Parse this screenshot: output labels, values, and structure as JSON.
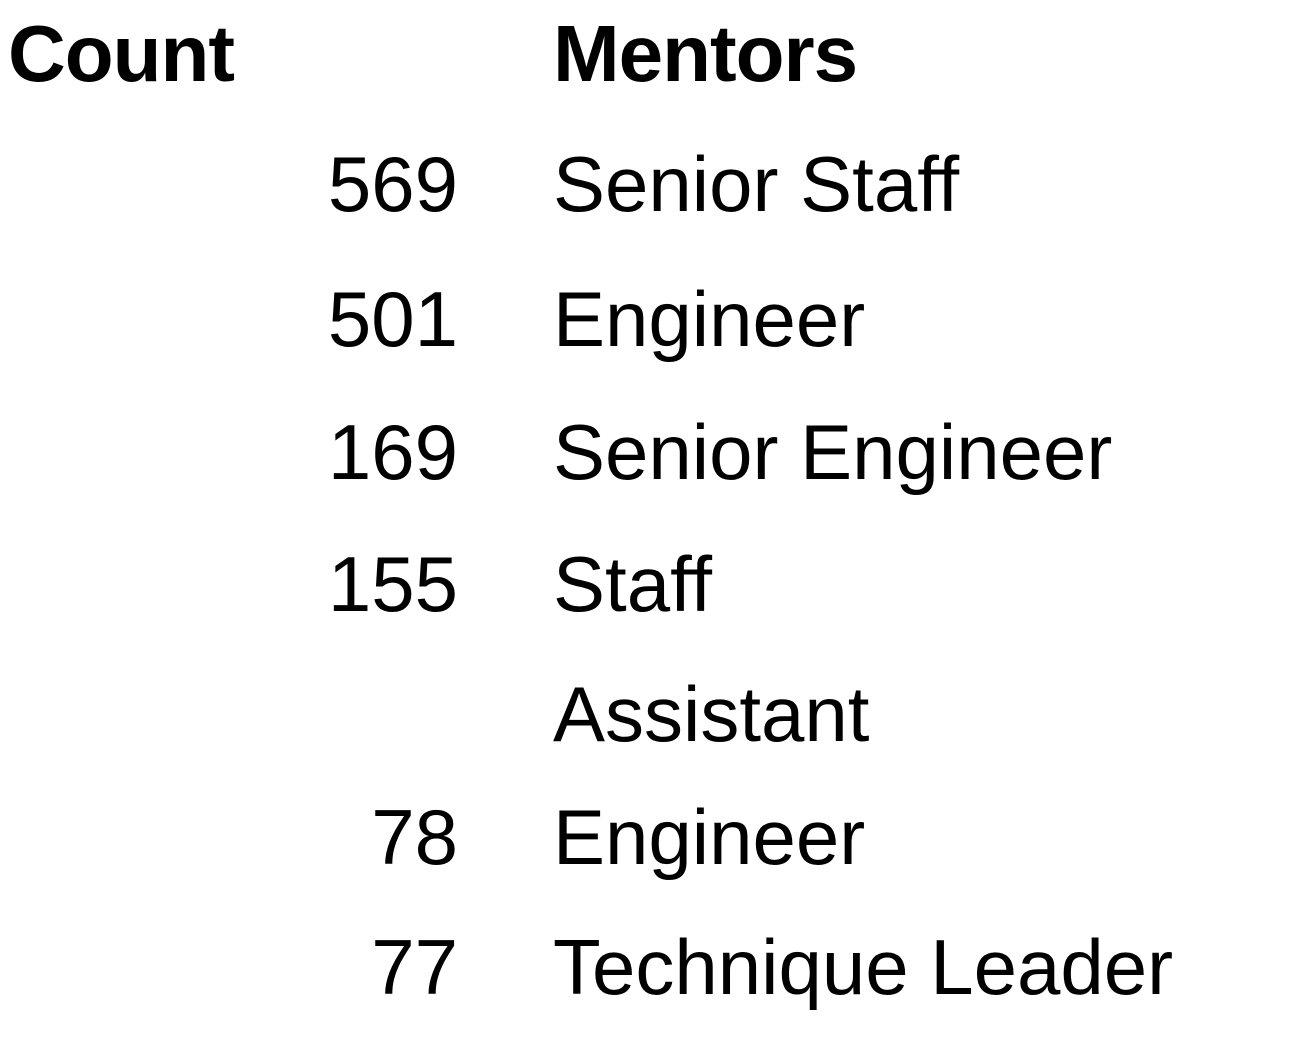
{
  "table": {
    "headers": {
      "count": "Count",
      "mentors": "Mentors"
    },
    "rows": [
      {
        "count": "569",
        "mentor": "Senior Staff"
      },
      {
        "count": "501",
        "mentor": "Engineer"
      },
      {
        "count": "169",
        "mentor": "Senior Engineer"
      },
      {
        "count": "155",
        "mentor": "Staff"
      },
      {
        "count": "78",
        "mentor_line1": "Assistant",
        "mentor_line2": "Engineer"
      },
      {
        "count": "77",
        "mentor": "Technique Leader"
      }
    ]
  }
}
